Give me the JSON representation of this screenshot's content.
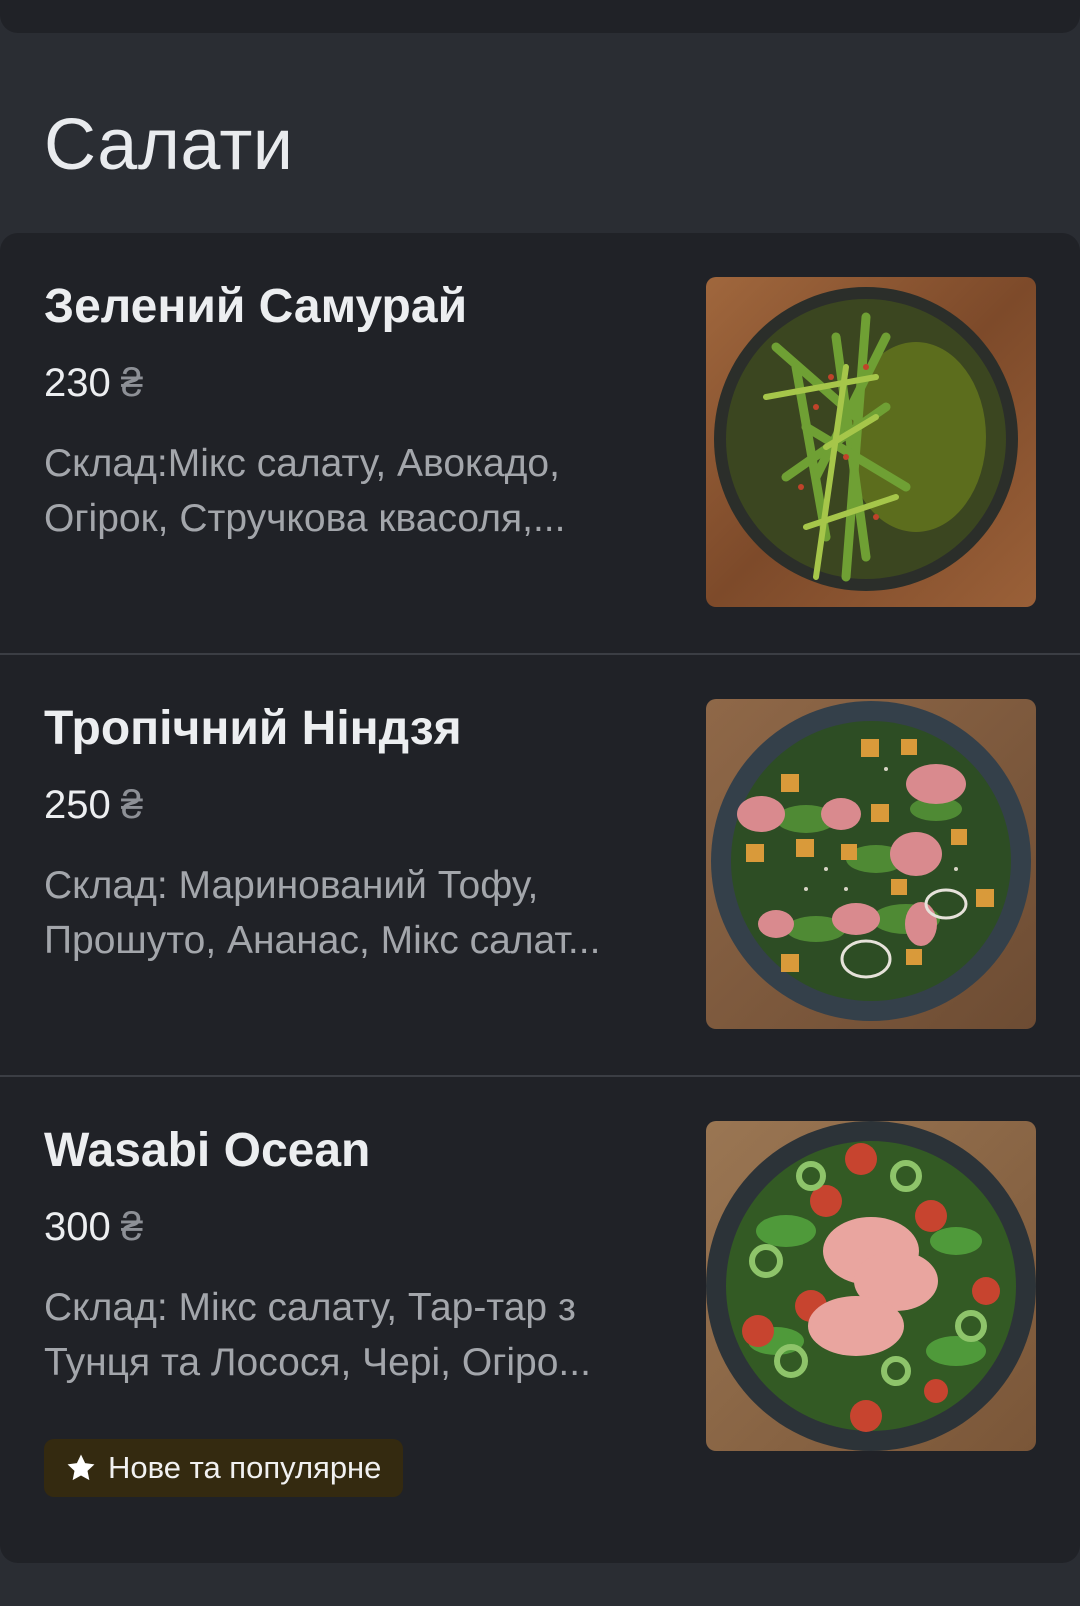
{
  "section": {
    "title": "Салати"
  },
  "currency_symbol": "₴",
  "items": [
    {
      "name": "Зелений Самурай",
      "price": "230",
      "desc_lines": [
        "Склад:Мікс салату, Авокадо,",
        "Огірок, Стручкова квасоля,..."
      ],
      "photo_icon": "green-salad-photo"
    },
    {
      "name": "Тропічний Ніндзя",
      "price": "250",
      "desc_lines": [
        "Склад: Маринований Тофу,",
        "Прошуто, Ананас, Мікс салат..."
      ],
      "photo_icon": "tofu-prosciutto-salad-photo"
    },
    {
      "name": "Wasabi Ocean",
      "price": "300",
      "desc_lines": [
        "Склад: Мікс салату, Тар-тар з",
        "Тунця та Лосося, Чері, Огіро..."
      ],
      "photo_icon": "tuna-salmon-salad-photo",
      "badge": "Нове та популярне"
    }
  ],
  "colors": {
    "background": "#2a2d33",
    "card": "#202227",
    "badge_bg": "#342a10",
    "muted_text": "#a3a6ab"
  }
}
